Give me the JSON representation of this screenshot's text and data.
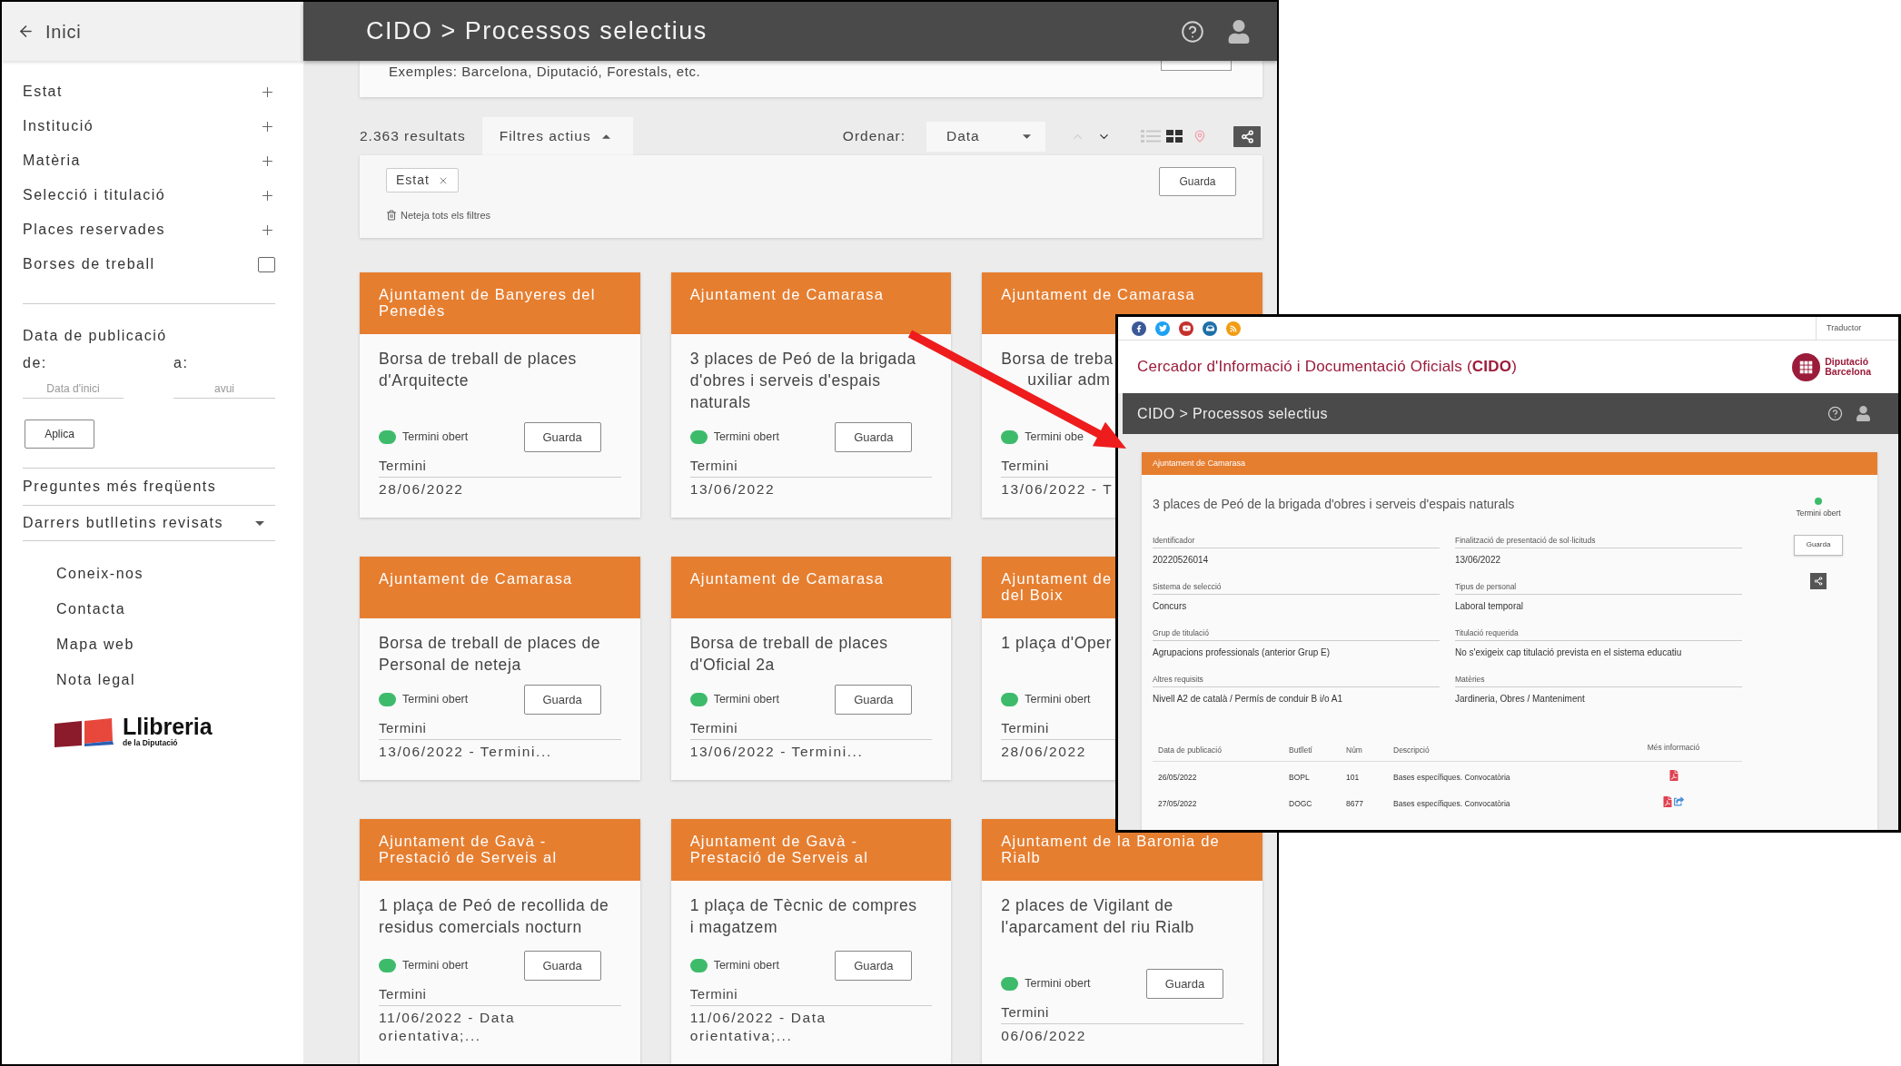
{
  "sidebar": {
    "back_link": "Inici",
    "filters": [
      {
        "label": "Estat",
        "kind": "expand",
        "expanded": false
      },
      {
        "label": "Institució",
        "kind": "expand",
        "expanded": false
      },
      {
        "label": "Matèria",
        "kind": "expand",
        "expanded": false
      },
      {
        "label": "Selecció i titulació",
        "kind": "expand",
        "expanded": false
      },
      {
        "label": "Places reservades",
        "kind": "expand",
        "expanded": false
      },
      {
        "label": "Borses de treball",
        "kind": "checkbox",
        "checked": false
      }
    ],
    "date_filter": {
      "title": "Data de publicació",
      "fields": [
        {
          "label": "de:",
          "placeholder": "Data d'inici"
        },
        {
          "label": "a:",
          "placeholder": "avui"
        }
      ],
      "button": "Aplica"
    },
    "links": [
      {
        "label": "Preguntes més freqüents",
        "kind": "link"
      },
      {
        "label": "Darrers butlletins revisats",
        "kind": "dropdown",
        "expanded": false
      }
    ],
    "footer_links": [
      "Coneix-nos",
      "Contacta",
      "Mapa web",
      "Nota legal"
    ],
    "logo": {
      "name": "Llibreria",
      "subtitle": "de la Diputació"
    }
  },
  "header": {
    "title": "CIDO > Processos selectius"
  },
  "search": {
    "hint": "Exemples: Barcelona, Diputació, Forestals, etc."
  },
  "results": {
    "count": "2.363 resultats",
    "filters_tab": {
      "label": "Filtres actius",
      "expanded": true
    },
    "sort_label": "Ordenar:",
    "sort_value": "Data",
    "sort_directions": [
      {
        "kind": "up",
        "selected": false
      },
      {
        "kind": "down",
        "selected": true
      }
    ],
    "views": [
      {
        "kind": "list",
        "selected": false
      },
      {
        "kind": "grid",
        "selected": true
      },
      {
        "kind": "map",
        "selected": false
      }
    ]
  },
  "active_filters": {
    "chips": [
      "Estat"
    ],
    "save_button": "Guarda",
    "clear": "Neteja tots els filtres"
  },
  "cards": [
    {
      "institution": "Ajuntament de Banyeres del Penedès",
      "title": "Borsa de treball de places d'Arquitecte",
      "open": true,
      "status": "Termini obert",
      "button": "Guarda",
      "deadline_label": "Termini",
      "deadline": "28/06/2022"
    },
    {
      "institution": "Ajuntament de Camarasa",
      "title": "3 places de Peó de la brigada d'obres i serveis d'espais naturals",
      "open": true,
      "status": "Termini obert",
      "button": "Guarda",
      "deadline_label": "Termini",
      "deadline": "13/06/2022"
    },
    {
      "institution": "Ajuntament de Camarasa",
      "title": "Borsa de treba",
      "title_fragment": "uxiliar adm",
      "open": true,
      "status": "Termini obe",
      "deadline_label": "Termini",
      "deadline": "13/06/2022 - T"
    },
    {
      "institution": "Ajuntament de Camarasa",
      "title": "Borsa de treball de places de Personal de neteja",
      "open": true,
      "status": "Termini obert",
      "button": "Guarda",
      "deadline_label": "Termini",
      "deadline": "13/06/2022 - Termini..."
    },
    {
      "institution": "Ajuntament de Camarasa",
      "title": "Borsa de treball de places d'Oficial 2a",
      "open": true,
      "status": "Termini obert",
      "button": "Guarda",
      "deadline_label": "Termini",
      "deadline": "13/06/2022 - Termini..."
    },
    {
      "institution": "Ajuntament de\ndel Boix",
      "title": "1 plaça d'Oper",
      "open": true,
      "status": "Termini obert",
      "deadline_label": "Termini",
      "deadline": "28/06/2022"
    },
    {
      "institution": "Ajuntament de Gavà - Prestació de Serveis al",
      "title": "1 plaça de Peó de recollida de residus comercials nocturn",
      "open": true,
      "status": "Termini obert",
      "button": "Guarda",
      "deadline_label": "Termini",
      "deadline": "11/06/2022 - Data orientativa;..."
    },
    {
      "institution": "Ajuntament de Gavà - Prestació de Serveis al",
      "title": "1 plaça de Tècnic de compres i magatzem",
      "open": true,
      "status": "Termini obert",
      "button": "Guarda",
      "deadline_label": "Termini",
      "deadline": "11/06/2022 - Data orientativa;..."
    },
    {
      "institution": "Ajuntament de la Baronia de Rialb",
      "title": "2 places de Vigilant de l'aparcament del riu Rialb",
      "open": true,
      "status": "Termini obert",
      "button": "Guarda",
      "deadline_label": "Termini",
      "deadline": "06/06/2022"
    }
  ],
  "detail": {
    "social": [
      {
        "kind": "facebook"
      },
      {
        "kind": "twitter"
      },
      {
        "kind": "youtube"
      },
      {
        "kind": "inbox"
      },
      {
        "kind": "rss"
      }
    ],
    "translator": "Traductor",
    "site_title": "Cercador d'Informació i Documentació Oficials (**CIDO**)",
    "logo_text": [
      "Diputació",
      "Barcelona"
    ],
    "title": "CIDO > Processos selectius",
    "institution": "Ajuntament de Camarasa",
    "heading": "3 places de Peó de la brigada d'obres i serveis d'espais naturals",
    "open": true,
    "status": "Termini obert",
    "button": "Guarda",
    "fields": [
      {
        "label": "Identificador",
        "value": "20220526014"
      },
      {
        "label": "Finalització de presentació de sol·licituds",
        "value": "13/06/2022"
      },
      {
        "label": "Sistema de selecció",
        "value": "Concurs"
      },
      {
        "label": "Tipus de personal",
        "value": "Laboral temporal"
      },
      {
        "label": "Grup de titulació",
        "value": "Agrupacions professionals (anterior Grup E)"
      },
      {
        "label": "Titulació requerida",
        "value": "No s'exigeix cap titulació prevista en el sistema educatiu"
      },
      {
        "label": "Altres requisits",
        "value": "Nivell A2 de català / Permís de conduir B i/o A1"
      },
      {
        "label": "Matèries",
        "value": "Jardineria, Obres / Manteniment"
      }
    ],
    "table": {
      "columns": [
        "Data de publicació",
        "Butlletí",
        "Núm",
        "Descripció",
        "Més informació"
      ],
      "rows": [
        {
          "cells": [
            "26/05/2022",
            "BOPL",
            "101",
            "Bases específiques. Convocatòria"
          ],
          "documents": [
            {
              "kind": "pdf"
            }
          ]
        },
        {
          "cells": [
            "27/05/2022",
            "DOGC",
            "8677",
            "Bases específiques. Convocatòria"
          ],
          "documents": [
            {
              "kind": "pdf"
            },
            {
              "kind": "link"
            }
          ]
        }
      ]
    }
  }
}
